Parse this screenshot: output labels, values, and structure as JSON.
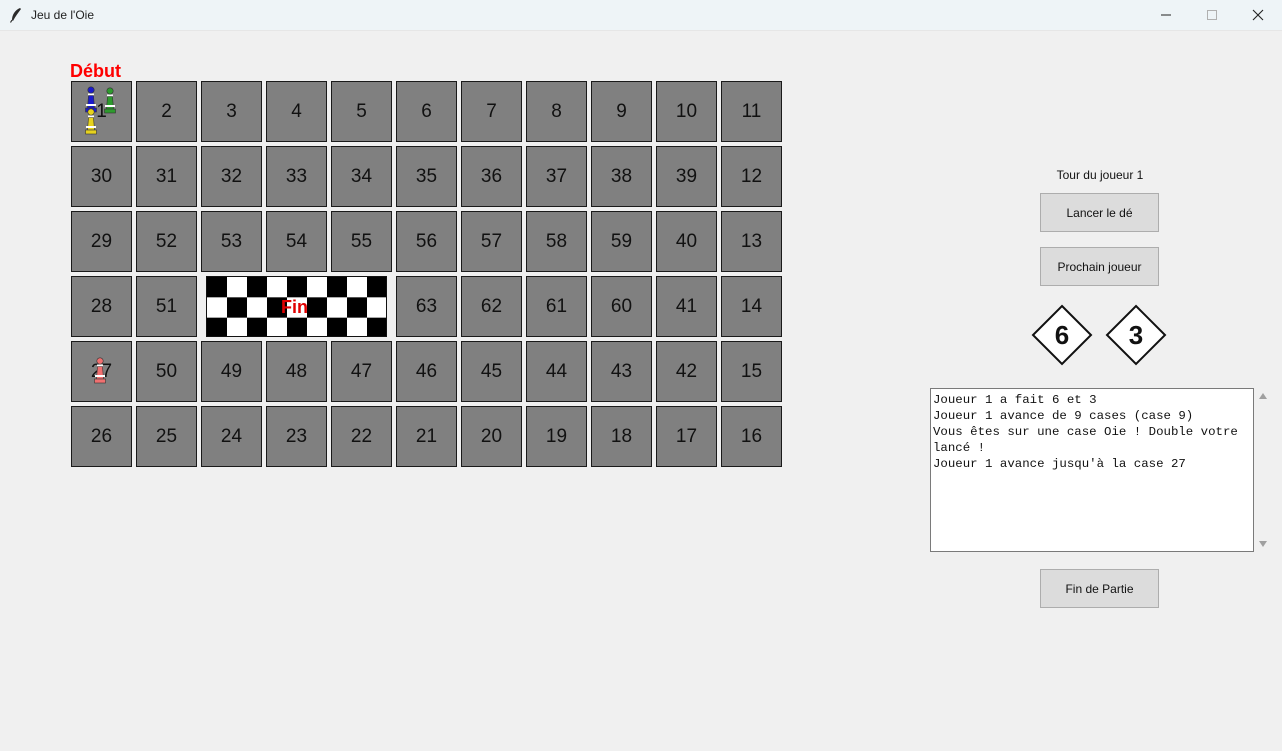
{
  "window": {
    "title": "Jeu de l'Oie"
  },
  "board": {
    "start_label": "Début",
    "finish_label": "Fin",
    "rows": [
      [
        "1",
        "2",
        "3",
        "4",
        "5",
        "6",
        "7",
        "8",
        "9",
        "10",
        "11"
      ],
      [
        "30",
        "31",
        "32",
        "33",
        "34",
        "35",
        "36",
        "37",
        "38",
        "39",
        "12"
      ],
      [
        "29",
        "52",
        "53",
        "54",
        "55",
        "56",
        "57",
        "58",
        "59",
        "40",
        "13"
      ],
      [
        "28",
        "51",
        "",
        "",
        "",
        "63",
        "62",
        "61",
        "60",
        "41",
        "14"
      ],
      [
        "27",
        "50",
        "49",
        "48",
        "47",
        "46",
        "45",
        "44",
        "43",
        "42",
        "15"
      ],
      [
        "26",
        "25",
        "24",
        "23",
        "22",
        "21",
        "20",
        "19",
        "18",
        "17",
        "16"
      ]
    ]
  },
  "pawns": [
    {
      "color": "#1a1acc",
      "square": "1"
    },
    {
      "color": "#2e9a2e",
      "square": "1"
    },
    {
      "color": "#e6d21e",
      "square": "1"
    },
    {
      "color": "#f07070",
      "square": "27"
    }
  ],
  "panel": {
    "turn_label": "Tour du joueur 1",
    "roll_button": "Lancer le dé",
    "next_player_button": "Prochain joueur",
    "die1": "6",
    "die2": "3",
    "end_button": "Fin de Partie"
  },
  "log": {
    "lines": [
      "Joueur 1 a fait 6 et 3",
      "Joueur 1 avance de 9 cases (case 9)",
      "Vous êtes sur une case Oie ! Double votre lancé !",
      "Joueur 1 avance jusqu'à la case 27"
    ]
  }
}
